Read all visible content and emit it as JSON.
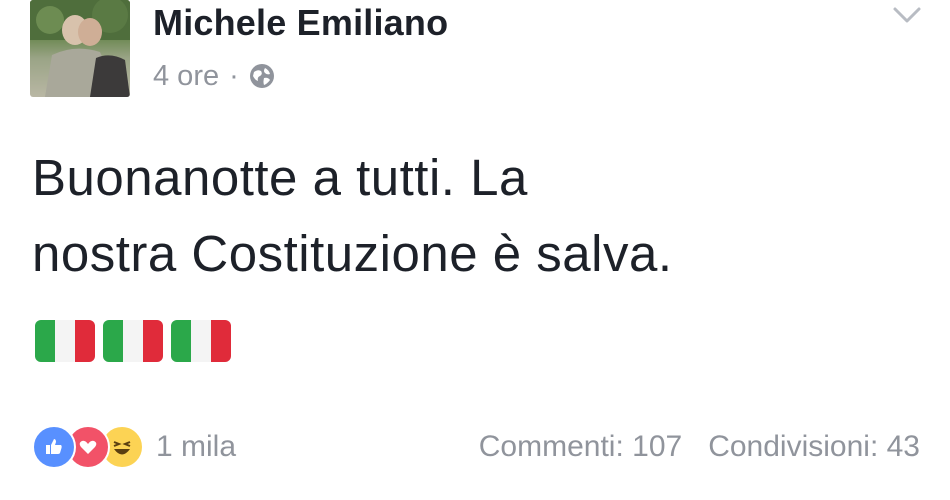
{
  "post": {
    "author": "Michele Emiliano",
    "time": "4 ore",
    "separator": "·",
    "privacy_icon": "globe-icon",
    "options_icon": "chevron-down-icon",
    "text_line1": "Buonanotte a tutti. La",
    "text_line2": "nostra Costituzione è salva.",
    "flags": [
      "italy-flag",
      "italy-flag",
      "italy-flag"
    ]
  },
  "reactions": {
    "icons": [
      "like-icon",
      "love-icon",
      "haha-icon"
    ],
    "count": "1 mila"
  },
  "stats": {
    "comments": "Commenti: 107",
    "shares": "Condivisioni: 43"
  },
  "colors": {
    "text": "#1d2129",
    "meta": "#90949c",
    "like": "#5890ff",
    "love": "#f25268",
    "haha": "#fcd354",
    "flag_green": "#2ba84a",
    "flag_white": "#f4f4f4",
    "flag_red": "#e02b3a"
  }
}
